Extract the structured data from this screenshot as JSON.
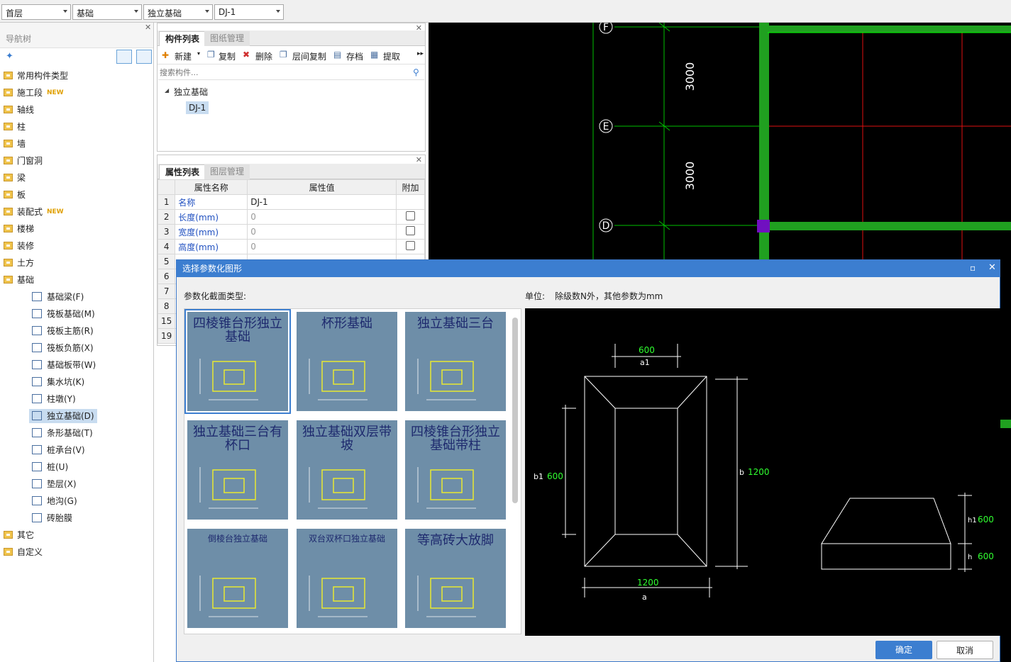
{
  "toolbar": {
    "floor": "首层",
    "category": "基础",
    "type": "独立基础",
    "member": "DJ-1"
  },
  "nav": {
    "title": "导航树",
    "items": [
      {
        "label": "常用构件类型",
        "new": false
      },
      {
        "label": "施工段",
        "new": true
      },
      {
        "label": "轴线",
        "new": false
      },
      {
        "label": "柱",
        "new": false
      },
      {
        "label": "墙",
        "new": false
      },
      {
        "label": "门窗洞",
        "new": false
      },
      {
        "label": "梁",
        "new": false
      },
      {
        "label": "板",
        "new": false
      },
      {
        "label": "装配式",
        "new": true
      },
      {
        "label": "楼梯",
        "new": false
      },
      {
        "label": "装修",
        "new": false
      },
      {
        "label": "土方",
        "new": false
      },
      {
        "label": "基础",
        "new": false
      }
    ],
    "sub": [
      "基础梁(F)",
      "筏板基础(M)",
      "筏板主筋(R)",
      "筏板负筋(X)",
      "基础板带(W)",
      "集水坑(K)",
      "柱墩(Y)",
      "独立基础(D)",
      "条形基础(T)",
      "桩承台(V)",
      "桩(U)",
      "垫层(X)",
      "地沟(G)",
      "砖胎膜"
    ],
    "tail": [
      "其它",
      "自定义"
    ],
    "new_tag": "NEW"
  },
  "components": {
    "tab1": "构件列表",
    "tab2": "图纸管理",
    "new": "新建",
    "copy": "复制",
    "delete": "删除",
    "floor_copy": "层间复制",
    "archive": "存档",
    "extract": "提取",
    "search_placeholder": "搜索构件...",
    "tree_root": "独立基础",
    "tree_child": "DJ-1"
  },
  "props": {
    "tab1": "属性列表",
    "tab2": "图层管理",
    "col_name": "属性名称",
    "col_value": "属性值",
    "col_add": "附加",
    "rows": [
      {
        "n": "1",
        "name": "名称",
        "value": "DJ-1"
      },
      {
        "n": "2",
        "name": "长度(mm)",
        "value": "0"
      },
      {
        "n": "3",
        "name": "宽度(mm)",
        "value": "0"
      },
      {
        "n": "4",
        "name": "高度(mm)",
        "value": "0"
      },
      {
        "n": "5",
        "name": "",
        "value": ""
      },
      {
        "n": "6",
        "name": "",
        "value": ""
      },
      {
        "n": "7",
        "name": "",
        "value": ""
      },
      {
        "n": "8",
        "name": "",
        "value": ""
      },
      {
        "n": "15",
        "name": "",
        "value": ""
      },
      {
        "n": "19",
        "name": "",
        "value": ""
      }
    ]
  },
  "cad": {
    "axes": [
      "F",
      "E",
      "D"
    ],
    "dims": [
      "3000",
      "3000"
    ]
  },
  "dialog": {
    "title": "选择参数化图形",
    "type_label": "参数化截面类型:",
    "unit_label": "单位:",
    "unit_text": "除级数N外，其他参数为mm",
    "thumbs": [
      "四棱锥台形独立基础",
      "杯形基础",
      "独立基础三台",
      "独立基础三台有杯口",
      "独立基础双层带坡",
      "四棱锥台形独立基础带柱",
      "倒棱台独立基础",
      "双台双杯口独立基础",
      "等高砖大放脚"
    ],
    "preview": {
      "a1": "600",
      "b1": "600",
      "b": "1200",
      "a": "1200",
      "h1": "600",
      "h": "600",
      "lbl_a1": "a1",
      "lbl_b1": "b1",
      "lbl_b": "b",
      "lbl_a": "a",
      "lbl_h1": "h1",
      "lbl_h": "h"
    },
    "ok": "确定",
    "cancel": "取消"
  }
}
